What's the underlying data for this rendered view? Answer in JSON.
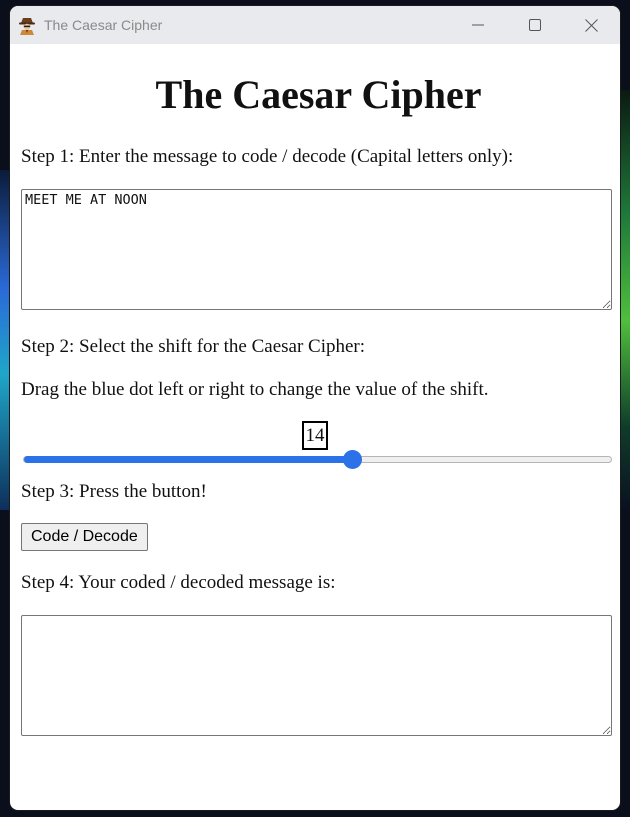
{
  "window": {
    "title": "The Caesar Cipher",
    "app_icon": "spy-icon",
    "controls": [
      "minimize-icon",
      "maximize-icon",
      "close-icon"
    ]
  },
  "page": {
    "heading": "The Caesar Cipher",
    "step1": "Step 1: Enter the message to code / decode (Capital letters only):",
    "input_message": "MEET ME AT NOON",
    "step2": "Step 2: Select the shift for the Caesar Cipher:",
    "step2_hint": "Drag the blue dot left or right to change the value of the shift.",
    "shift": {
      "value": "14",
      "min": 0,
      "max": 25,
      "fraction": 0.56
    },
    "step3": "Step 3: Press the button!",
    "button_label": "Code / Decode",
    "step4": "Step 4: Your coded / decoded message is:",
    "output_message": ""
  },
  "colors": {
    "accent": "#2b72e8",
    "titlebar": "#e9eaee"
  }
}
